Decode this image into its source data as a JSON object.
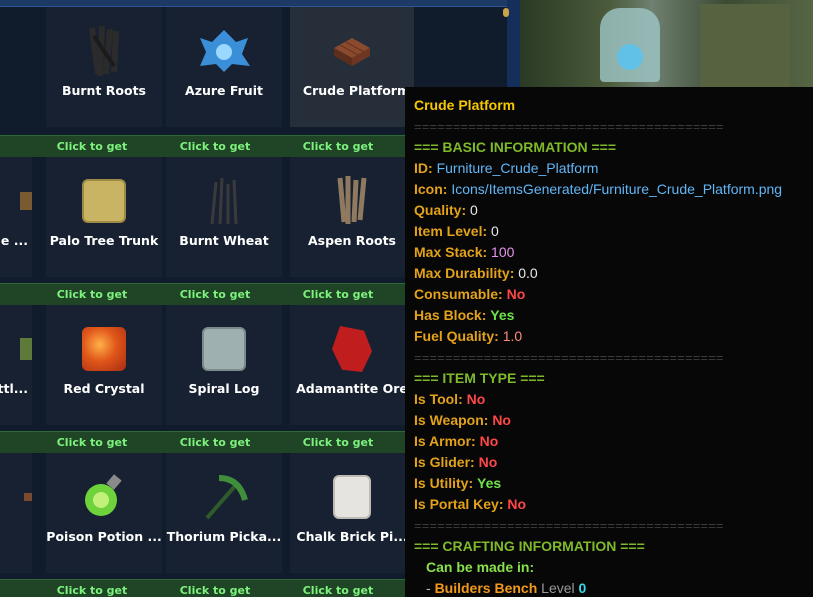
{
  "grid": {
    "cells": [
      {
        "name": "Burnt Roots"
      },
      {
        "name": "Azure Fruit"
      },
      {
        "name": "Crude Platform"
      },
      {
        "name": "ne ..."
      },
      {
        "name": "Palo Tree Trunk"
      },
      {
        "name": "Burnt Wheat"
      },
      {
        "name": "Aspen Roots"
      },
      {
        "name": "attl..."
      },
      {
        "name": "Red Crystal"
      },
      {
        "name": "Spiral Log"
      },
      {
        "name": "Adamantite Ore"
      },
      {
        "name": "Poison Potion ..."
      },
      {
        "name": "Thorium Picka..."
      },
      {
        "name": "Chalk Brick Pi..."
      }
    ],
    "get_label": "Click to get"
  },
  "tooltip": {
    "title": "Crude Platform",
    "sep": "========================================",
    "basic_header": "=== BASIC INFORMATION ===",
    "id_label": "ID:",
    "id_value": "Furniture_Crude_Platform",
    "icon_label": "Icon:",
    "icon_value": "Icons/ItemsGenerated/Furniture_Crude_Platform.png",
    "quality_label": "Quality:",
    "quality_value": "0",
    "item_level_label": "Item Level:",
    "item_level_value": "0",
    "max_stack_label": "Max Stack:",
    "max_stack_value": "100",
    "max_durability_label": "Max Durability:",
    "max_durability_value": "0.0",
    "consumable_label": "Consumable:",
    "consumable_value": "No",
    "has_block_label": "Has Block:",
    "has_block_value": "Yes",
    "fuel_quality_label": "Fuel Quality:",
    "fuel_quality_value": "1.0",
    "type_header": "=== ITEM TYPE ===",
    "is_tool_label": "Is Tool:",
    "is_tool_value": "No",
    "is_weapon_label": "Is Weapon:",
    "is_weapon_value": "No",
    "is_armor_label": "Is Armor:",
    "is_armor_value": "No",
    "is_glider_label": "Is Glider:",
    "is_glider_value": "No",
    "is_utility_label": "Is Utility:",
    "is_utility_value": "Yes",
    "is_portal_key_label": "Is Portal Key:",
    "is_portal_key_value": "No",
    "crafting_header": "=== CRAFTING INFORMATION ===",
    "can_be_made_label": "Can be made in:",
    "bench_dash": "-",
    "bench_name": "Builders Bench",
    "bench_level_label": "Level",
    "bench_level_value": "0"
  },
  "colors": {
    "title": "#f5c800",
    "section": "#7fba2a",
    "label": "#e3a21a",
    "yes": "#6de24a",
    "no": "#ff4747",
    "get": "#7df27d"
  }
}
